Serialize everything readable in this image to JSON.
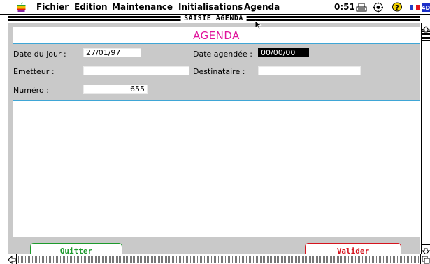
{
  "menubar": {
    "items": [
      "Fichier",
      "Edition",
      "Maintenance",
      "Initialisations",
      "Agenda"
    ],
    "clock": "0:51",
    "icons": [
      "apple-icon",
      "printer-icon",
      "control-panel-icon",
      "help-icon",
      "french-flag-icon",
      "app-switcher-icon"
    ]
  },
  "window": {
    "title": "SAISIE AGENDA"
  },
  "form": {
    "header": "AGENDA",
    "date_jour_label": "Date du jour :",
    "date_jour_value": "27/01/97",
    "date_agendee_label": "Date agendée :",
    "date_agendee_value": "00/00/00",
    "emetteur_label": "Emetteur :",
    "emetteur_value": "",
    "destinataire_label": "Destinataire :",
    "destinataire_value": "",
    "numero_label": "Numéro :",
    "numero_value": "655",
    "notes_value": ""
  },
  "buttons": {
    "quit": "Quitter",
    "validate": "Valider"
  },
  "colors": {
    "header_text": "#e0139b",
    "border_accent": "#3fa6d6",
    "quit": "#1d9a2c",
    "validate": "#d6141e",
    "background": "#c9c9c9"
  }
}
